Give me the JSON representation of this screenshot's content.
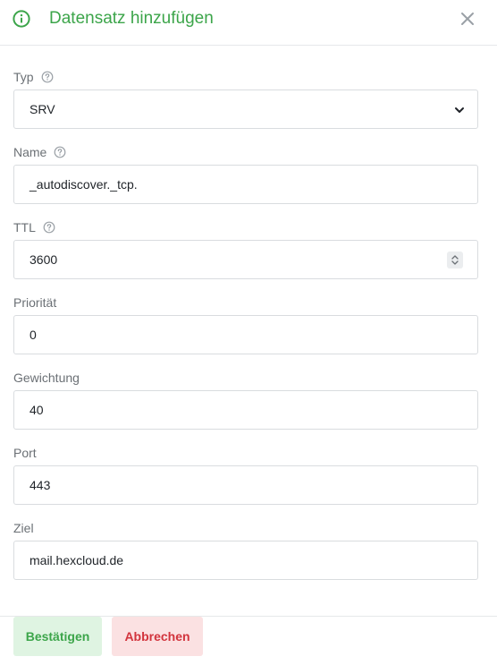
{
  "dialog": {
    "title": "Datensatz hinzufügen"
  },
  "fields": {
    "type": {
      "label": "Typ",
      "value": "SRV"
    },
    "name": {
      "label": "Name",
      "value": "_autodiscover._tcp."
    },
    "ttl": {
      "label": "TTL",
      "value": "3600"
    },
    "priority": {
      "label": "Priorität",
      "value": "0"
    },
    "weight": {
      "label": "Gewichtung",
      "value": "40"
    },
    "port": {
      "label": "Port",
      "value": "443"
    },
    "target": {
      "label": "Ziel",
      "value": "mail.hexcloud.de"
    }
  },
  "footer": {
    "confirm_label": "Bestätigen",
    "cancel_label": "Abbrechen"
  },
  "colors": {
    "accent_green": "#3ca54a",
    "danger_red": "#d2343d",
    "label_gray": "#6b7075"
  },
  "icons": {
    "header": "info-circle-icon",
    "close": "close-icon",
    "help": "question-circle-icon",
    "select": "chevron-down-icon",
    "spinner": "up-down-chevron-icon"
  }
}
